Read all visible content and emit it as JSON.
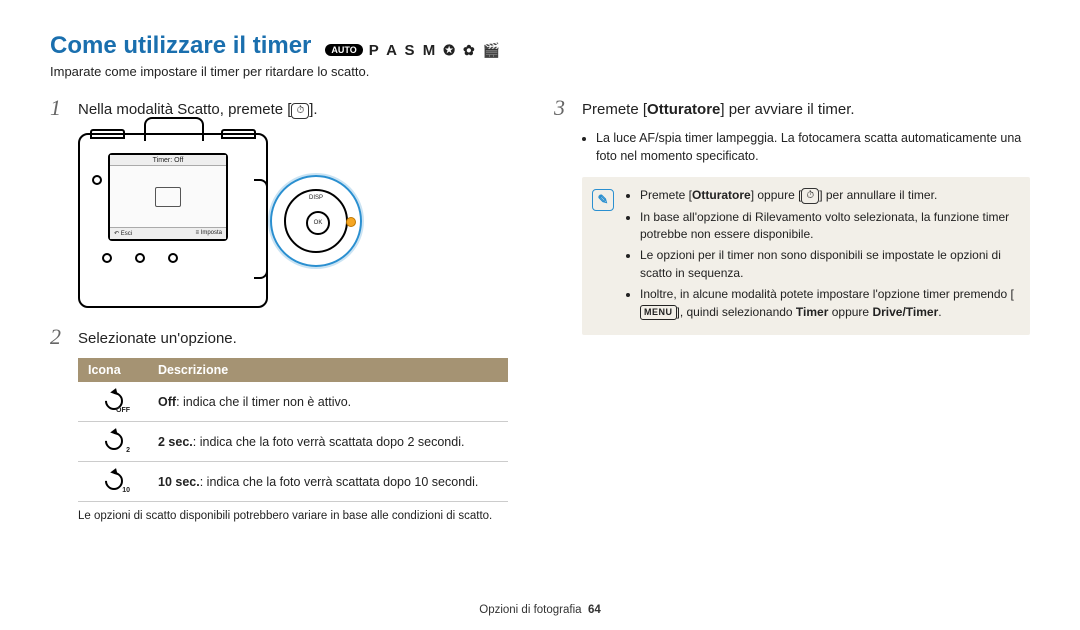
{
  "title": "Come utilizzare il timer",
  "modes": {
    "auto_badge": "AUTO",
    "letters": "P A S M"
  },
  "intro": "Imparate come impostare il timer per ritardare lo scatto.",
  "step1": {
    "num": "1",
    "text_before": "Nella modalità Scatto, premete [",
    "text_after": "]."
  },
  "camera_screen": {
    "bar": "Timer: Off",
    "foot_left_icon": "↶",
    "foot_left": "Esci",
    "foot_right_icon": "≡",
    "foot_right": "Imposta"
  },
  "dpad": {
    "center": "OK",
    "top": "DISP"
  },
  "step2": {
    "num": "2",
    "text": "Selezionate un'opzione."
  },
  "table": {
    "head_icon": "Icona",
    "head_desc": "Descrizione",
    "rows": [
      {
        "sub": "OFF",
        "bold": "Off",
        "rest": ": indica che il timer non è attivo."
      },
      {
        "sub": "2",
        "bold": "2 sec.",
        "rest": ": indica che la foto verrà scattata dopo 2 secondi."
      },
      {
        "sub": "10",
        "bold": "10 sec.",
        "rest": ": indica che la foto verrà scattata dopo 10 secondi."
      }
    ]
  },
  "footnote": "Le opzioni di scatto disponibili potrebbero variare in base alle condizioni di scatto.",
  "step3": {
    "num": "3",
    "text_before": "Premete [",
    "bold": "Otturatore",
    "text_after": "] per avviare il timer.",
    "sub": "La luce AF/spia timer lampeggia. La fotocamera scatta automaticamente una foto nel momento specificato."
  },
  "note": {
    "items": [
      {
        "pre": "Premete [",
        "b1": "Otturatore",
        "mid": "] oppure [",
        "icon": "⏱",
        "post": "] per annullare il timer."
      },
      {
        "text": "In base all'opzione di Rilevamento volto selezionata, la funzione timer potrebbe non essere disponibile."
      },
      {
        "text": "Le opzioni per il timer non sono disponibili se impostate le opzioni di scatto in sequenza."
      },
      {
        "pre": "Inoltre, in alcune modalità potete impostare l'opzione timer premendo [",
        "menu": "MENU",
        "mid2": "], quindi selezionando ",
        "b1": "Timer",
        "or": " oppure ",
        "b2": "Drive/Timer",
        "post": "."
      }
    ]
  },
  "footer": {
    "section": "Opzioni di fotografia",
    "page": "64"
  }
}
